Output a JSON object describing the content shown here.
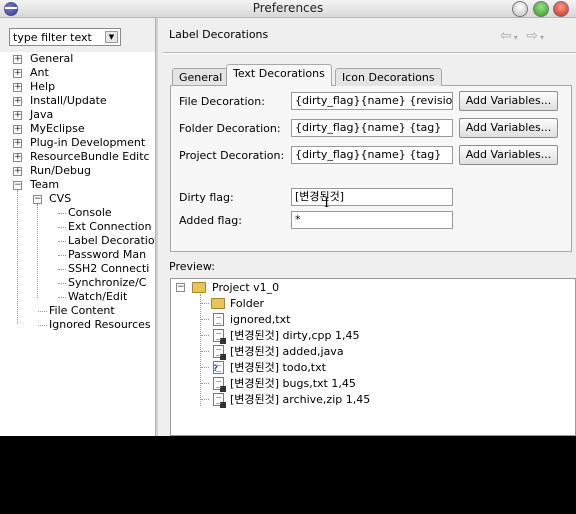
{
  "window": {
    "title": "Preferences"
  },
  "filter": {
    "value": "type filter text"
  },
  "tree": {
    "items": [
      {
        "label": "General",
        "level": 0,
        "expander": "+"
      },
      {
        "label": "Ant",
        "level": 0,
        "expander": "+"
      },
      {
        "label": "Help",
        "level": 0,
        "expander": "+"
      },
      {
        "label": "Install/Update",
        "level": 0,
        "expander": "+"
      },
      {
        "label": "Java",
        "level": 0,
        "expander": "+"
      },
      {
        "label": "MyEclipse",
        "level": 0,
        "expander": "+"
      },
      {
        "label": "Plug-in Development",
        "level": 0,
        "expander": "+"
      },
      {
        "label": "ResourceBundle Editc",
        "level": 0,
        "expander": "+"
      },
      {
        "label": "Run/Debug",
        "level": 0,
        "expander": "+"
      },
      {
        "label": "Team",
        "level": 0,
        "expander": "−"
      },
      {
        "label": "CVS",
        "level": 1,
        "expander": "−"
      },
      {
        "label": "Console",
        "level": 2
      },
      {
        "label": "Ext Connection",
        "level": 2
      },
      {
        "label": "Label Decoratio",
        "level": 2
      },
      {
        "label": "Password Man",
        "level": 2
      },
      {
        "label": "SSH2 Connecti",
        "level": 2
      },
      {
        "label": "Synchronize/C",
        "level": 2
      },
      {
        "label": "Watch/Edit",
        "level": 2
      },
      {
        "label": "File Content",
        "level": 1
      },
      {
        "label": "Ignored Resources",
        "level": 1
      }
    ]
  },
  "page": {
    "title": "Label Decorations"
  },
  "tabs": [
    {
      "label": "General"
    },
    {
      "label": "Text Decorations",
      "active": true
    },
    {
      "label": "Icon Decorations"
    }
  ],
  "decorations": {
    "file": {
      "label": "File Decoration:",
      "value": "{dirty_flag}{name}  {revision"
    },
    "folder": {
      "label": "Folder Decoration:",
      "value": "{dirty_flag}{name}  {tag}"
    },
    "project": {
      "label": "Project Decoration:",
      "value": "{dirty_flag}{name}  {tag}"
    },
    "add_variables_label": "Add Variables..."
  },
  "flags": {
    "dirty": {
      "label": "Dirty flag:",
      "value": "[변경된것]"
    },
    "added": {
      "label": "Added flag:",
      "value": "*"
    }
  },
  "preview": {
    "label": "Preview:",
    "project": "Project  v1_0",
    "items": [
      {
        "text": "Folder",
        "icon": "folder-icon"
      },
      {
        "text": "ignored,txt",
        "icon": "file-icon"
      },
      {
        "text": "[변경된것] dirty,cpp  1,45",
        "icon": "file-icon"
      },
      {
        "text": "[변경된것] added,java",
        "icon": "file-icon"
      },
      {
        "text": "[변경된것] todo,txt",
        "icon": "unknown-file-icon"
      },
      {
        "text": "[변경된것] bugs,txt  1,45",
        "icon": "file-icon"
      },
      {
        "text": "[변경된것] archive,zip  1,45",
        "icon": "file-icon"
      }
    ]
  }
}
